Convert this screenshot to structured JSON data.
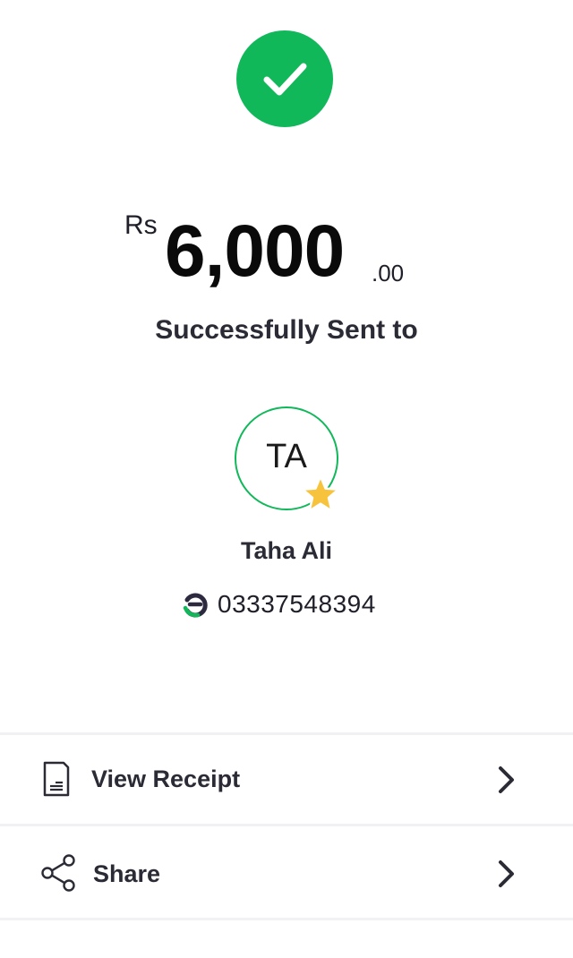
{
  "status": {
    "icon": "check-icon",
    "color": "#10b85a"
  },
  "amount": {
    "currency": "Rs",
    "major": "6,000",
    "minor": ".00"
  },
  "status_text": "Successfully Sent to",
  "recipient": {
    "initials": "TA",
    "favorite_icon": "star-icon",
    "name": "Taha Ali",
    "wallet_icon": "easypaisa-logo-icon",
    "number": "03337548394"
  },
  "actions": [
    {
      "label": "View Receipt",
      "icon": "receipt-icon"
    },
    {
      "label": "Share",
      "icon": "share-icon"
    }
  ],
  "colors": {
    "accent": "#10b85a",
    "star": "#f8c33c",
    "text": "#2b2b36"
  }
}
